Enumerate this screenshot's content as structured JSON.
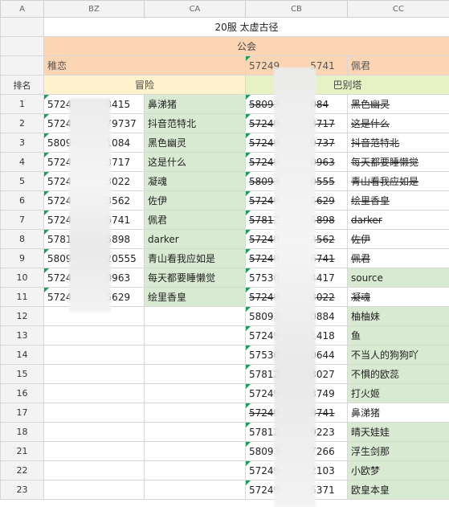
{
  "columns": [
    "A",
    "BZ",
    "CA",
    "CB",
    "CC"
  ],
  "title": "20服 太虚古径",
  "guild": "公会",
  "header3": {
    "bz": "稚恋",
    "cb": "57249",
    "cb_tail": "5741",
    "cc": "佩君"
  },
  "row4": {
    "rank": "排名",
    "left": "冒险",
    "right": "巴别塔"
  },
  "rows": [
    {
      "n": "1",
      "bz_a": "5724",
      "bz_b": "8415",
      "ca": "鼻涕猪",
      "cb_a": "58093",
      "cb_b": "084",
      "cc": "黑色幽灵",
      "cb_strike": true,
      "cc_strike": true,
      "cc_green": false
    },
    {
      "n": "2",
      "bz_a": "5724",
      "bz_b": "79737",
      "ca": "抖音范特北",
      "cb_a": "57249",
      "cb_b": "3717",
      "cc": "这是什么",
      "cb_strike": true,
      "cc_strike": true,
      "cc_green": false
    },
    {
      "n": "3",
      "bz_a": "5809",
      "bz_b": "1084",
      "ca": "黑色幽灵",
      "cb_a": "57249",
      "cb_b": "9737",
      "cc": "抖音范特北",
      "cb_strike": true,
      "cc_strike": true,
      "cc_green": false
    },
    {
      "n": "4",
      "bz_a": "5724",
      "bz_b": "3717",
      "ca": "这是什么",
      "cb_a": "57249",
      "cb_b": "0963",
      "cc": "每天都要睡懒觉",
      "cb_strike": true,
      "cc_strike": true,
      "cc_green": false
    },
    {
      "n": "5",
      "bz_a": "5724",
      "bz_b": "3022",
      "ca": "凝魂",
      "cb_a": "58093",
      "cb_b": "0555",
      "cc": "青山看我应如是",
      "cb_strike": true,
      "cc_strike": true,
      "cc_green": false
    },
    {
      "n": "6",
      "bz_a": "5724",
      "bz_b": "3562",
      "ca": "佐伊",
      "cb_a": "57249",
      "cb_b": "5629",
      "cc": "绘里香皇",
      "cb_strike": true,
      "cc_strike": true,
      "cc_green": false
    },
    {
      "n": "7",
      "bz_a": "5724",
      "bz_b": "6741",
      "ca": "佩君",
      "cb_a": "57812",
      "cb_b": "5898",
      "cc": "darker",
      "cb_strike": true,
      "cc_strike": true,
      "cc_green": false
    },
    {
      "n": "8",
      "bz_a": "5781",
      "bz_b": "5898",
      "ca": "darker",
      "cb_a": "57249",
      "cb_b": "3562",
      "cc": "佐伊",
      "cb_strike": true,
      "cc_strike": true,
      "cc_green": false
    },
    {
      "n": "9",
      "bz_a": "5809",
      "bz_b": "20555",
      "ca": "青山看我应如是",
      "cb_a": "57249",
      "cb_b": "6741",
      "cc": "佩君",
      "cb_strike": true,
      "cc_strike": true,
      "cc_green": false
    },
    {
      "n": "10",
      "bz_a": "5724",
      "bz_b": "0963",
      "ca": "每天都要睡懒觉",
      "cb_a": "57530",
      "cb_b": "4417",
      "cc": "source",
      "cb_strike": false,
      "cc_strike": false,
      "cc_green": true
    },
    {
      "n": "11",
      "bz_a": "5724",
      "bz_b": "5629",
      "ca": "绘里香皇",
      "cb_a": "57249",
      "cb_b": "3022",
      "cc": "凝魂",
      "cb_strike": true,
      "cc_strike": true,
      "cc_green": false
    },
    {
      "n": "12",
      "bz_a": "",
      "bz_b": "",
      "ca": "",
      "cb_a": "58093",
      "cb_b": "0884",
      "cc": "柚柚妹",
      "cb_strike": false,
      "cc_strike": false,
      "cc_green": true
    },
    {
      "n": "13",
      "bz_a": "",
      "bz_b": "",
      "ca": "",
      "cb_a": "57249",
      "cb_b": "1418",
      "cc": "鱼",
      "cb_strike": false,
      "cc_strike": false,
      "cc_green": true
    },
    {
      "n": "14",
      "bz_a": "",
      "bz_b": "",
      "ca": "",
      "cb_a": "57530",
      "cb_b": "0644",
      "cc": "不当人的狗狗吖",
      "cb_strike": false,
      "cc_strike": false,
      "cc_green": true
    },
    {
      "n": "15",
      "bz_a": "",
      "bz_b": "",
      "ca": "",
      "cb_a": "57812",
      "cb_b": "3027",
      "cc": "不惧的欧蕊",
      "cb_strike": false,
      "cc_strike": false,
      "cc_green": true
    },
    {
      "n": "16",
      "bz_a": "",
      "bz_b": "",
      "ca": "",
      "cb_a": "57249",
      "cb_b": "3749",
      "cc": "打火姬",
      "cb_strike": false,
      "cc_strike": false,
      "cc_green": true
    },
    {
      "n": "17",
      "bz_a": "",
      "bz_b": "",
      "ca": "",
      "cb_a": "57249",
      "cb_b": "8741",
      "cc": "鼻涕猪",
      "cb_strike": true,
      "cc_strike": false,
      "cc_green": false
    },
    {
      "n": "18",
      "bz_a": "",
      "bz_b": "",
      "ca": "",
      "cb_a": "57812",
      "cb_b": "9223",
      "cc": "晴天娃娃",
      "cb_strike": false,
      "cc_strike": false,
      "cc_green": true
    },
    {
      "n": "21",
      "bz_a": "",
      "bz_b": "",
      "ca": "",
      "cb_a": "58093",
      "cb_b": "7266",
      "cc": "浮生剑那",
      "cb_strike": false,
      "cc_strike": false,
      "cc_green": true
    },
    {
      "n": "22",
      "bz_a": "",
      "bz_b": "",
      "ca": "",
      "cb_a": "57249",
      "cb_b": "2103",
      "cc": "小欧梦",
      "cb_strike": false,
      "cc_strike": false,
      "cc_green": true
    },
    {
      "n": "23",
      "bz_a": "",
      "bz_b": "",
      "ca": "",
      "cb_a": "57249",
      "cb_b": "5371",
      "cc": "欧皇本皇",
      "cb_strike": false,
      "cc_strike": false,
      "cc_green": true
    }
  ]
}
